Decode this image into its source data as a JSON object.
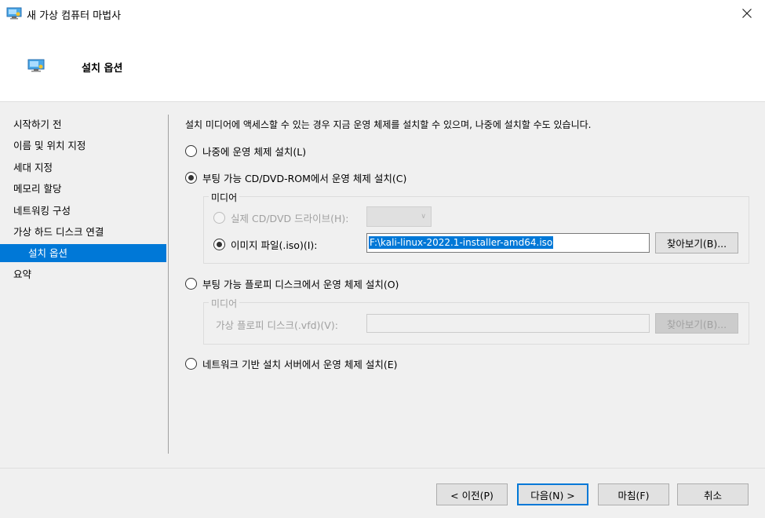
{
  "window": {
    "title": "새 가상 컴퓨터 마법사",
    "close_icon": "close-icon"
  },
  "header": {
    "title": "설치 옵션",
    "icon": "monitor-icon"
  },
  "nav": {
    "items": [
      {
        "label": "시작하기 전"
      },
      {
        "label": "이름 및 위치 지정"
      },
      {
        "label": "세대 지정"
      },
      {
        "label": "메모리 할당"
      },
      {
        "label": "네트워킹 구성"
      },
      {
        "label": "가상 하드 디스크 연결"
      },
      {
        "label": "설치 옵션"
      },
      {
        "label": "요약"
      }
    ],
    "selected": "설치 옵션"
  },
  "content": {
    "description": "설치 미디어에 액세스할 수 있는 경우 지금 운영 체제를 설치할 수 있으며, 나중에 설치할 수도 있습니다.",
    "option_later": "나중에 운영 체제 설치(L)",
    "option_cd": "부팅 가능 CD/DVD-ROM에서 운영 체제 설치(C)",
    "cd_media_group": "미디어",
    "cd_physical": "실제 CD/DVD 드라이브(H):",
    "cd_physical_value": "",
    "cd_image": "이미지 파일(.iso)(I):",
    "cd_image_path": "F:\\kali-linux-2022.1-installer-amd64.iso",
    "cd_browse": "찾아보기(B)...",
    "option_floppy": "부팅 가능 플로피 디스크에서 운영 체제 설치(O)",
    "floppy_media_group": "미디어",
    "floppy_label": "가상 플로피 디스크(.vfd)(V):",
    "floppy_path": "",
    "floppy_browse": "찾아보기(B)...",
    "option_network": "네트워크 기반 설치 서버에서 운영 체제 설치(E)",
    "selected_option": "cd",
    "selected_cd_source": "image"
  },
  "footer": {
    "prev": "< 이전(P)",
    "next": "다음(N) >",
    "finish": "마침(F)",
    "cancel": "취소"
  },
  "colors": {
    "accent": "#0078d7",
    "background": "#f0f0f0"
  }
}
